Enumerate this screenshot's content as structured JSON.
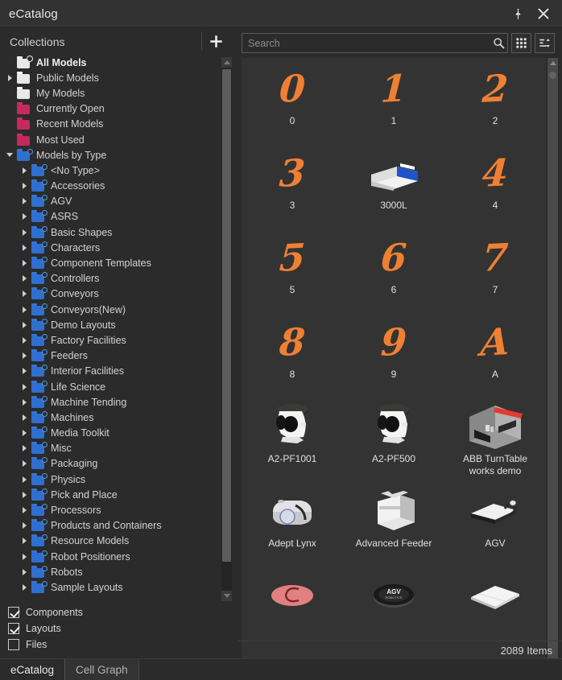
{
  "window": {
    "title": "eCatalog",
    "pin_icon": "pin-icon",
    "close_icon": "close-icon"
  },
  "left_panel": {
    "header": {
      "title": "Collections",
      "add_label": "+",
      "add_icon": "plus-icon"
    },
    "tree": [
      {
        "label": "All Models",
        "indent": 0,
        "twisty": "none",
        "icon": "folder-gear",
        "bold": true
      },
      {
        "label": "Public Models",
        "indent": 0,
        "twisty": "right",
        "icon": "folder-white",
        "bold": false
      },
      {
        "label": "My Models",
        "indent": 0,
        "twisty": "none",
        "icon": "folder-white",
        "bold": false
      },
      {
        "label": "Currently Open",
        "indent": 0,
        "twisty": "none",
        "icon": "folder-pink",
        "bold": false
      },
      {
        "label": "Recent Models",
        "indent": 0,
        "twisty": "none",
        "icon": "folder-pink",
        "bold": false
      },
      {
        "label": "Most Used",
        "indent": 0,
        "twisty": "none",
        "icon": "folder-pink",
        "bold": false
      },
      {
        "label": "Models by Type",
        "indent": 0,
        "twisty": "down",
        "icon": "folder-blue",
        "bold": false
      },
      {
        "label": "<No Type>",
        "indent": 1,
        "twisty": "right",
        "icon": "folder-blue",
        "bold": false
      },
      {
        "label": "Accessories",
        "indent": 1,
        "twisty": "right",
        "icon": "folder-blue",
        "bold": false
      },
      {
        "label": "AGV",
        "indent": 1,
        "twisty": "right",
        "icon": "folder-blue",
        "bold": false
      },
      {
        "label": "ASRS",
        "indent": 1,
        "twisty": "right",
        "icon": "folder-blue",
        "bold": false
      },
      {
        "label": "Basic Shapes",
        "indent": 1,
        "twisty": "right",
        "icon": "folder-blue",
        "bold": false
      },
      {
        "label": "Characters",
        "indent": 1,
        "twisty": "right",
        "icon": "folder-blue",
        "bold": false
      },
      {
        "label": "Component Templates",
        "indent": 1,
        "twisty": "right",
        "icon": "folder-blue",
        "bold": false
      },
      {
        "label": "Controllers",
        "indent": 1,
        "twisty": "right",
        "icon": "folder-blue",
        "bold": false
      },
      {
        "label": "Conveyors",
        "indent": 1,
        "twisty": "right",
        "icon": "folder-blue",
        "bold": false
      },
      {
        "label": "Conveyors(New)",
        "indent": 1,
        "twisty": "right",
        "icon": "folder-blue",
        "bold": false
      },
      {
        "label": "Demo Layouts",
        "indent": 1,
        "twisty": "right",
        "icon": "folder-blue",
        "bold": false
      },
      {
        "label": "Factory Facilities",
        "indent": 1,
        "twisty": "right",
        "icon": "folder-blue",
        "bold": false
      },
      {
        "label": "Feeders",
        "indent": 1,
        "twisty": "right",
        "icon": "folder-blue",
        "bold": false
      },
      {
        "label": "Interior Facilities",
        "indent": 1,
        "twisty": "right",
        "icon": "folder-blue",
        "bold": false
      },
      {
        "label": "Life Science",
        "indent": 1,
        "twisty": "right",
        "icon": "folder-blue",
        "bold": false
      },
      {
        "label": "Machine Tending",
        "indent": 1,
        "twisty": "right",
        "icon": "folder-blue",
        "bold": false
      },
      {
        "label": "Machines",
        "indent": 1,
        "twisty": "right",
        "icon": "folder-blue",
        "bold": false
      },
      {
        "label": "Media Toolkit",
        "indent": 1,
        "twisty": "right",
        "icon": "folder-blue",
        "bold": false
      },
      {
        "label": "Misc",
        "indent": 1,
        "twisty": "right",
        "icon": "folder-blue",
        "bold": false
      },
      {
        "label": "Packaging",
        "indent": 1,
        "twisty": "right",
        "icon": "folder-blue",
        "bold": false
      },
      {
        "label": "Physics",
        "indent": 1,
        "twisty": "right",
        "icon": "folder-blue",
        "bold": false
      },
      {
        "label": "Pick and Place",
        "indent": 1,
        "twisty": "right",
        "icon": "folder-blue",
        "bold": false
      },
      {
        "label": "Processors",
        "indent": 1,
        "twisty": "right",
        "icon": "folder-blue",
        "bold": false
      },
      {
        "label": "Products and Containers",
        "indent": 1,
        "twisty": "right",
        "icon": "folder-blue",
        "bold": false
      },
      {
        "label": "Resource Models",
        "indent": 1,
        "twisty": "right",
        "icon": "folder-blue",
        "bold": false
      },
      {
        "label": "Robot Positioners",
        "indent": 1,
        "twisty": "right",
        "icon": "folder-blue",
        "bold": false
      },
      {
        "label": "Robots",
        "indent": 1,
        "twisty": "right",
        "icon": "folder-blue",
        "bold": false
      },
      {
        "label": "Sample Layouts",
        "indent": 1,
        "twisty": "right",
        "icon": "folder-blue",
        "bold": false
      }
    ],
    "filters": [
      {
        "label": "Components",
        "checked": true
      },
      {
        "label": "Layouts",
        "checked": true
      },
      {
        "label": "Files",
        "checked": false
      }
    ]
  },
  "splitter_tab": {
    "label": "Collections",
    "collapse_icon": "double-chevron-left-icon",
    "collapse_glyph": "«"
  },
  "right_panel": {
    "search": {
      "value": "",
      "placeholder": "Search",
      "search_icon": "search-icon"
    },
    "view_buttons": [
      {
        "name": "grid-view-button",
        "icon": "grid-icon"
      },
      {
        "name": "sort-button",
        "icon": "sort-icon"
      }
    ],
    "items": [
      {
        "label": "0",
        "thumb": "glyph",
        "glyph": "0"
      },
      {
        "label": "1",
        "thumb": "glyph",
        "glyph": "1"
      },
      {
        "label": "2",
        "thumb": "glyph",
        "glyph": "2"
      },
      {
        "label": "3",
        "thumb": "glyph",
        "glyph": "3"
      },
      {
        "label": "3000L",
        "thumb": "machine-3000l"
      },
      {
        "label": "4",
        "thumb": "glyph",
        "glyph": "4"
      },
      {
        "label": "5",
        "thumb": "glyph",
        "glyph": "5"
      },
      {
        "label": "6",
        "thumb": "glyph",
        "glyph": "6"
      },
      {
        "label": "7",
        "thumb": "glyph",
        "glyph": "7"
      },
      {
        "label": "8",
        "thumb": "glyph",
        "glyph": "8"
      },
      {
        "label": "9",
        "thumb": "glyph",
        "glyph": "9"
      },
      {
        "label": "A",
        "thumb": "glyph",
        "glyph": "A"
      },
      {
        "label": "A2-PF1001",
        "thumb": "robot-pf"
      },
      {
        "label": "A2-PF500",
        "thumb": "robot-pf"
      },
      {
        "label": "ABB TurnTable works demo",
        "thumb": "turntable-cell"
      },
      {
        "label": "Adept Lynx",
        "thumb": "adept-lynx"
      },
      {
        "label": "Advanced Feeder",
        "thumb": "advanced-feeder"
      },
      {
        "label": "AGV",
        "thumb": "agv-vehicle"
      },
      {
        "label": "",
        "thumb": "pink-disc"
      },
      {
        "label": "",
        "thumb": "agv-puck"
      },
      {
        "label": "",
        "thumb": "white-plate"
      }
    ],
    "status": {
      "items_count": "2089 Items"
    }
  },
  "bottom_tabs": [
    {
      "label": "eCatalog",
      "active": true
    },
    {
      "label": "Cell Graph",
      "active": false
    }
  ],
  "colors": {
    "accent_orange": "#ef8033",
    "folder_blue": "#2f6fd0",
    "folder_pink": "#c6285f",
    "folder_white": "#e8e8e8",
    "bg_dark": "#2b2b2b",
    "bg_grid": "#333333",
    "titlebar": "#323232"
  }
}
